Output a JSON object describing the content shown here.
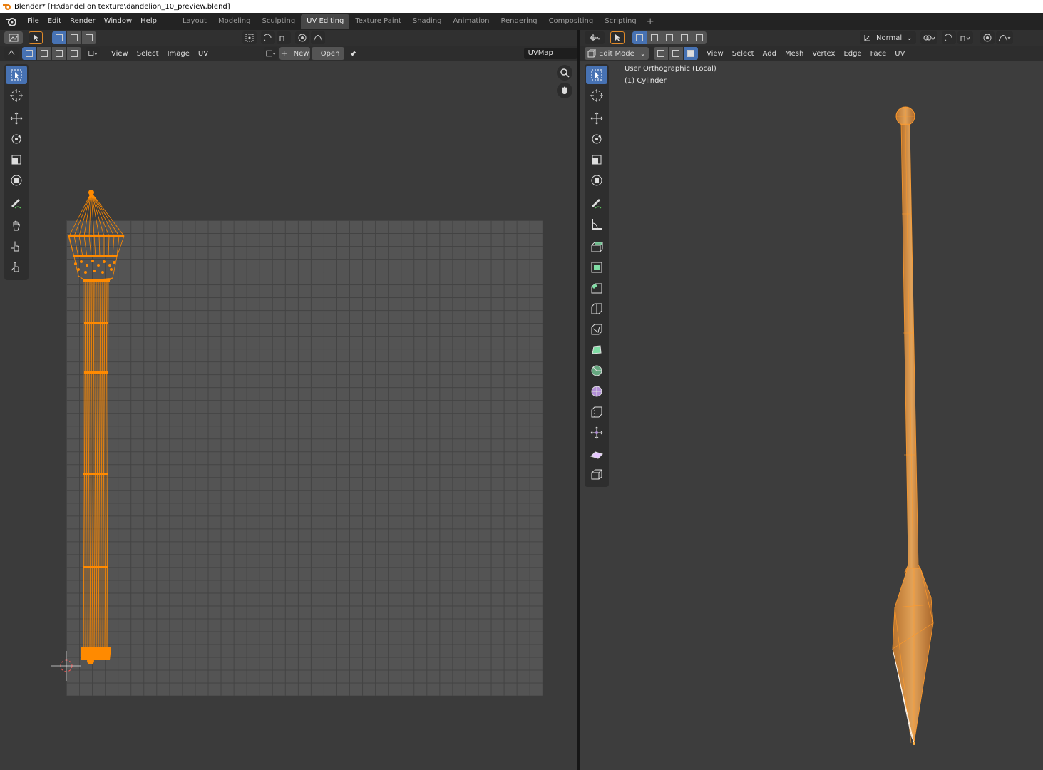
{
  "window": {
    "title": "Blender* [H:\\dandelion texture\\dandelion_10_preview.blend]"
  },
  "menu": [
    "File",
    "Edit",
    "Render",
    "Window",
    "Help"
  ],
  "workspaces": {
    "tabs": [
      "Layout",
      "Modeling",
      "Sculpting",
      "UV Editing",
      "Texture Paint",
      "Shading",
      "Animation",
      "Rendering",
      "Compositing",
      "Scripting"
    ],
    "active": "UV Editing",
    "add_label": "+"
  },
  "uv_editor": {
    "menus": [
      "View",
      "Select",
      "Image",
      "UV"
    ],
    "new_label": "New",
    "open_label": "Open",
    "uvmap_value": "UVMap",
    "tools": [
      "select-box",
      "cursor",
      "move",
      "rotate",
      "scale",
      "transform",
      "annotate",
      "grab",
      "relax",
      "pinch"
    ]
  },
  "viewport": {
    "mode_label": "Edit Mode",
    "menus": [
      "View",
      "Select",
      "Add",
      "Mesh",
      "Vertex",
      "Edge",
      "Face",
      "UV"
    ],
    "orientation_label": "Normal",
    "view_name": "User Orthographic (Local)",
    "object_name": "(1) Cylinder",
    "tools": [
      "select-box",
      "cursor",
      "move",
      "rotate",
      "scale",
      "transform",
      "annotate",
      "measure",
      "extrude",
      "inset",
      "bevel",
      "loop-cut",
      "knife",
      "poly-build",
      "spin",
      "smooth",
      "edge-slide",
      "shrink-fatten",
      "shear",
      "rip"
    ]
  },
  "colors": {
    "accent": "#4772b3",
    "mesh_orange": "#ff8a00",
    "mesh_fill": "#c97c2a",
    "uv_grid": "#545454"
  }
}
